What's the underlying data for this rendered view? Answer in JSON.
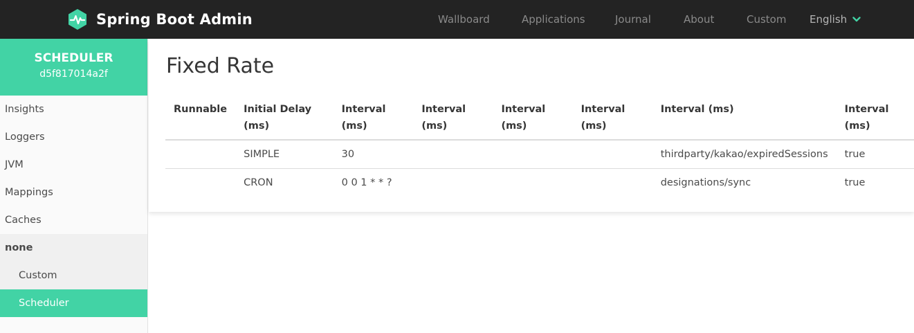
{
  "navbar": {
    "brand": "Spring Boot Admin",
    "items": [
      "Wallboard",
      "Applications",
      "Journal",
      "About",
      "Custom"
    ],
    "language": "English"
  },
  "sidebar": {
    "app_name": "SCHEDULER",
    "app_id": "d5f817014a2f",
    "items": [
      "Insights",
      "Loggers",
      "JVM",
      "Mappings",
      "Caches"
    ],
    "group": {
      "label": "none",
      "items": [
        "Custom",
        "Scheduler"
      ]
    }
  },
  "main": {
    "title": "Fixed Rate",
    "table": {
      "headers": [
        "Runnable",
        "Initial Delay (ms)",
        "Interval (ms)",
        "Interval (ms)",
        "Interval (ms)",
        "Interval (ms)",
        "Interval (ms)",
        "Interval (ms)"
      ],
      "rows": [
        [
          "",
          "SIMPLE",
          "30",
          "",
          "",
          "",
          "thirdparty/kakao/expiredSessions",
          "true"
        ],
        [
          "",
          "CRON",
          "0 0 1 * * ?",
          "",
          "",
          "",
          "designations/sync",
          "true"
        ]
      ]
    }
  },
  "colors": {
    "accent": "#42d3a5",
    "navbar": "#232323"
  }
}
